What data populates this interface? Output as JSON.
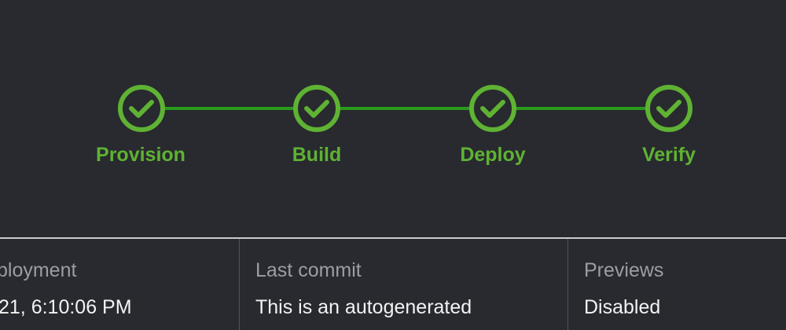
{
  "pipeline": {
    "steps": [
      {
        "label": "Provision",
        "status": "succeeded",
        "icon": "check-circle-icon"
      },
      {
        "label": "Build",
        "status": "succeeded",
        "icon": "check-circle-icon"
      },
      {
        "label": "Deploy",
        "status": "succeeded",
        "icon": "check-circle-icon"
      },
      {
        "label": "Verify",
        "status": "succeeded",
        "icon": "check-circle-icon"
      }
    ]
  },
  "details": {
    "deployment": {
      "label": "ployment",
      "value": "21, 6:10:06 PM"
    },
    "last_commit": {
      "label": "Last commit",
      "value": "This is an autogenerated"
    },
    "previews": {
      "label": "Previews",
      "value": "Disabled"
    }
  },
  "colors": {
    "background": "#282a2f",
    "success": "#5fb233",
    "connector": "#2b9a1c",
    "label_muted": "#9a9ea4",
    "value_text": "#f2f3f3"
  }
}
